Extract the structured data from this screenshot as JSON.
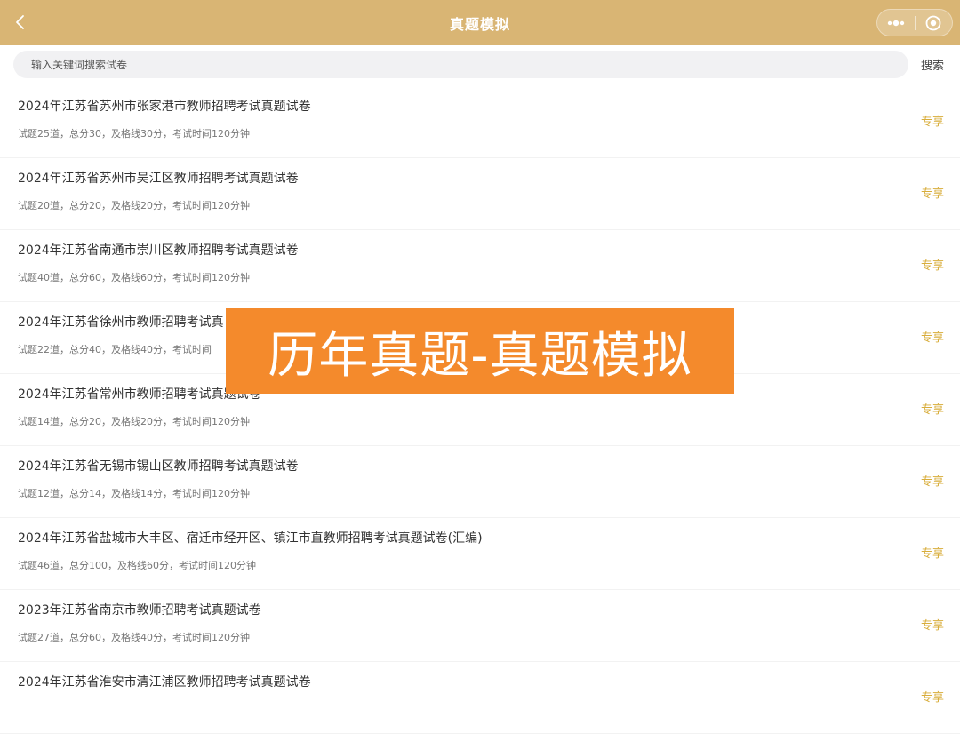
{
  "nav": {
    "title": "真题模拟",
    "back_icon": "chevron-left-icon",
    "more_icon": "more-dots-icon",
    "close_icon": "target-circle-icon"
  },
  "search": {
    "placeholder": "输入关键词搜索试卷",
    "value": "",
    "button_label": "搜索"
  },
  "papers": [
    {
      "title": "2024年江苏省苏州市张家港市教师招聘考试真题试卷",
      "meta": "试题25道，总分30，及格线30分，考试时间120分钟",
      "badge": "专享"
    },
    {
      "title": "2024年江苏省苏州市吴江区教师招聘考试真题试卷",
      "meta": "试题20道，总分20，及格线20分，考试时间120分钟",
      "badge": "专享"
    },
    {
      "title": "2024年江苏省南通市崇川区教师招聘考试真题试卷",
      "meta": "试题40道，总分60，及格线60分，考试时间120分钟",
      "badge": "专享"
    },
    {
      "title": "2024年江苏省徐州市教师招聘考试真",
      "meta": "试题22道，总分40，及格线40分，考试时间",
      "badge": "专享"
    },
    {
      "title": "2024年江苏省常州市教师招聘考试真题试卷",
      "meta": "试题14道，总分20，及格线20分，考试时间120分钟",
      "badge": "专享"
    },
    {
      "title": "2024年江苏省无锡市锡山区教师招聘考试真题试卷",
      "meta": "试题12道，总分14，及格线14分，考试时间120分钟",
      "badge": "专享"
    },
    {
      "title": "2024年江苏省盐城市大丰区、宿迁市经开区、镇江市直教师招聘考试真题试卷(汇编)",
      "meta": "试题46道，总分100，及格线60分，考试时间120分钟",
      "badge": "专享"
    },
    {
      "title": "2023年江苏省南京市教师招聘考试真题试卷",
      "meta": "试题27道，总分60，及格线40分，考试时间120分钟",
      "badge": "专享"
    },
    {
      "title": "2024年江苏省淮安市清江浦区教师招聘考试真题试卷",
      "meta": "",
      "badge": "专享"
    }
  ],
  "overlay": {
    "text": "历年真题-真题模拟",
    "color": "#f48a2c"
  },
  "colors": {
    "nav_bg": "#d9b574",
    "badge": "#d8ad3b"
  }
}
